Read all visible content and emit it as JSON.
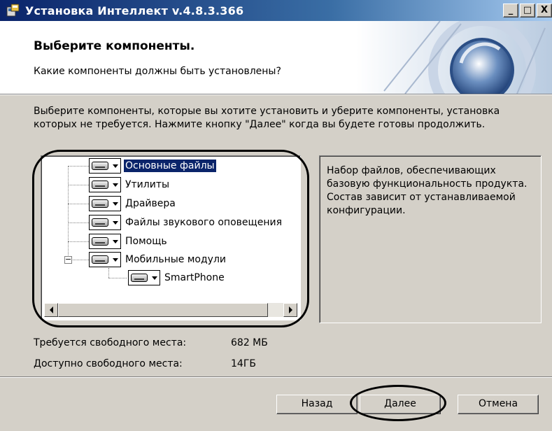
{
  "window": {
    "title": "Установка Интеллект v.4.8.3.366",
    "controls": {
      "minimize": "_",
      "maximize": "□",
      "close": "X"
    }
  },
  "header": {
    "title": "Выберите компоненты.",
    "subtitle": "Какие компоненты должны быть установлены?"
  },
  "instructions": "Выберите компоненты, которые вы хотите установить и уберите компоненты, установка которых не требуется. Нажмите кнопку \"Далее\" когда вы будете готовы продолжить.",
  "components": [
    {
      "label": "Основные файлы",
      "selected": true,
      "icon": "drive-icon"
    },
    {
      "label": "Утилиты",
      "selected": false,
      "icon": "drive-icon"
    },
    {
      "label": "Драйвера",
      "selected": false,
      "icon": "drive-icon"
    },
    {
      "label": "Файлы звукового оповещения",
      "selected": false,
      "icon": "drive-icon"
    },
    {
      "label": "Помощь",
      "selected": false,
      "icon": "drive-icon"
    },
    {
      "label": "Мобильные модули",
      "selected": false,
      "icon": "drive-icon",
      "expanded": true,
      "children": [
        {
          "label": "SmartPhone",
          "icon": "drive-icon"
        }
      ]
    }
  ],
  "description": "Набор файлов, обеспечивающих базовую функциональность продукта. Состав зависит от устанавливаемой конфигурации.",
  "space": {
    "required_label": "Требуется свободного места:",
    "required_value": "682 МБ",
    "available_label": "Доступно свободного места:",
    "available_value": "14ГБ"
  },
  "buttons": {
    "back": "Назад",
    "next": "Далее",
    "cancel": "Отмена"
  },
  "colors": {
    "selection": "#0a246a",
    "titlebar": "#0a246a",
    "face": "#d4d0c8"
  }
}
